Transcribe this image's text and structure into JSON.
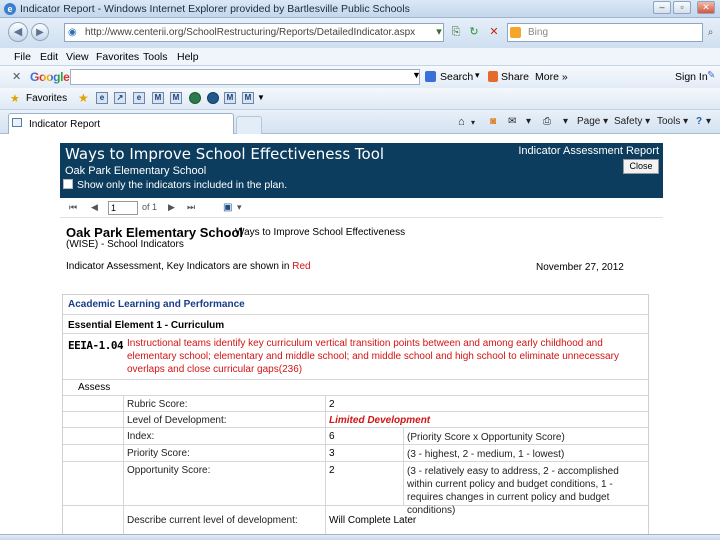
{
  "window": {
    "title": "Indicator Report - Windows Internet Explorer provided by Bartlesville Public Schools"
  },
  "address_bar": {
    "url": "http://www.centerii.org/SchoolRestructuring/Reports/DetailedIndicator.aspx",
    "search_placeholder": "Bing"
  },
  "menu": {
    "file": "File",
    "edit": "Edit",
    "view": "View",
    "favorites": "Favorites",
    "tools": "Tools",
    "help": "Help"
  },
  "google_toolbar": {
    "logo": "Google",
    "search": "Search",
    "share": "Share",
    "more": "More »",
    "sign_in": "Sign In"
  },
  "favorites_bar": {
    "label": "Favorites"
  },
  "tab": {
    "title": "Indicator Report"
  },
  "command_bar": {
    "page": "Page",
    "safety": "Safety",
    "tools": "Tools"
  },
  "report": {
    "title": "Ways to Improve School Effectiveness Tool",
    "subtitle": "Indicator Assessment Report",
    "school": "Oak Park Elementary School",
    "close_label": "Close",
    "filter_label": "Show only the indicators included in the plan.",
    "page_current": "1",
    "page_of": "of 1"
  },
  "detail": {
    "school_name": "Oak Park Elementary School",
    "tool_name": "Ways to Improve School Effectiveness",
    "sub": "(WISE) - School Indicators",
    "assess_line_prefix": "Indicator Assessment, Key Indicators are shown in",
    "assess_line_red": "Red",
    "date": "November 27, 2012"
  },
  "table": {
    "area": "Academic Learning and Performance",
    "element": "Essential Element 1 - Curriculum",
    "indicator_code": "EEIA-1.04",
    "indicator_text": "Instructional teams identify key curriculum vertical transition points between and among early childhood and elementary school; elementary and middle school; and middle school and high school to eliminate unnecessary overlaps and close curricular gaps(236)",
    "assess_label": "Assess",
    "rows": [
      {
        "label": "Rubric Score:",
        "value": "2",
        "note": ""
      },
      {
        "label": "Level of Development:",
        "value": "Limited Development",
        "note": ""
      },
      {
        "label": "Index:",
        "value": "6",
        "note": "(Priority Score x Opportunity Score)"
      },
      {
        "label": "Priority Score:",
        "value": "3",
        "note": "(3 - highest, 2 - medium, 1 - lowest)"
      },
      {
        "label": "Opportunity Score:",
        "value": "2",
        "note": "(3 - relatively easy to address, 2 - accomplished within current policy and budget conditions, 1 - requires changes in current policy and budget conditions)"
      },
      {
        "label": "Describe current level of development:",
        "value": "Will Complete Later",
        "note": ""
      }
    ]
  }
}
